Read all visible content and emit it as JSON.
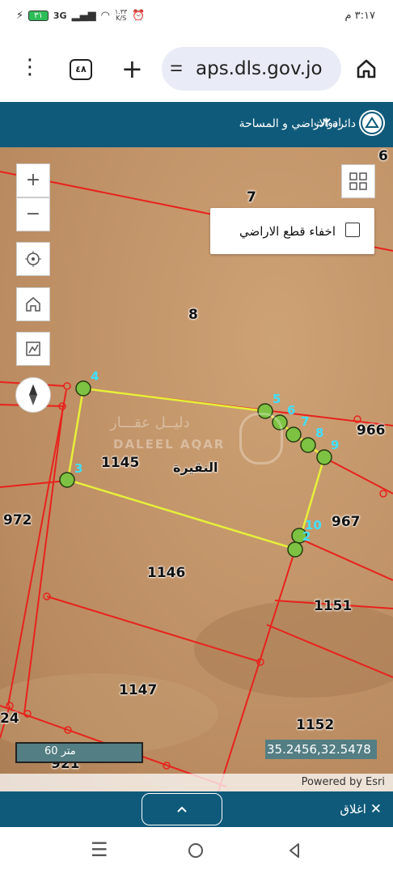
{
  "status_bar": {
    "time": "٣:١٧ م",
    "battery": "٣١",
    "network": "3G",
    "speed_value": "١.٣٣",
    "speed_unit": "K/S"
  },
  "browser": {
    "url": "aps.dls.gov.jo",
    "tab_count": "٤٨",
    "menu_icon": "more-vert-icon",
    "new_tab_icon": "plus-icon",
    "home_icon": "home-icon",
    "site_settings_icon": "tune-icon"
  },
  "app_header": {
    "title": "دائرة الاراضي و المساحة",
    "tools_label": "ادوات"
  },
  "map": {
    "toggle_label": "اخفاء قطع الاراضي",
    "toggle_checked": false,
    "area_name": "النقيرة",
    "watermark_ar": "دليــل عقـــار",
    "watermark_en": "DALEEL AQAR",
    "scale_label": "60 متر",
    "coordinates": "35.2456,32.5478",
    "attribution": "Powered by Esri",
    "parcels": [
      "6",
      "7",
      "8",
      "1145",
      "966",
      "967",
      "972",
      "1146",
      "1151",
      "1147",
      "24",
      "1152",
      "921"
    ],
    "vertices": [
      "4",
      "5",
      "6",
      "7",
      "8",
      "9",
      "10",
      "2",
      "3"
    ],
    "controls": [
      "zoom-in-icon",
      "zoom-out-icon",
      "locate-icon",
      "home-icon",
      "measure-icon",
      "compass-icon",
      "basemap-gallery-icon"
    ]
  },
  "bottom_bar": {
    "expand_icon": "chevron-up-icon",
    "close_label": "اغلاق"
  },
  "nav_bar": {
    "recent": "recents-icon",
    "home": "home-circle-icon",
    "back": "back-icon"
  },
  "colors": {
    "header_bg": "#0f5a7a",
    "parcel_lines": "#e8221c",
    "selected_boundary": "#e6f03a",
    "vertex_fill": "#7dc242",
    "vertex_label": "#3fe0ff",
    "url_bar": "#e9ecf6"
  }
}
